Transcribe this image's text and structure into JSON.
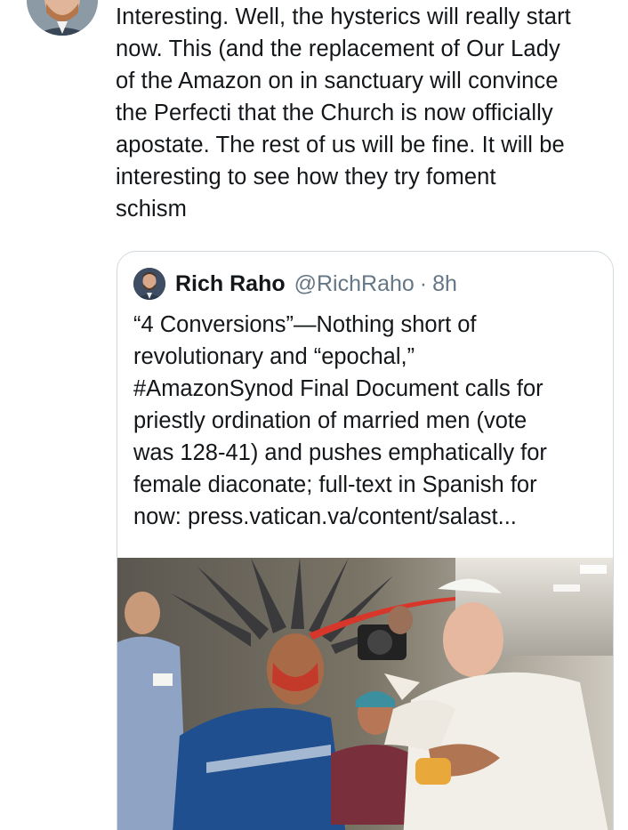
{
  "tweet": {
    "author_avatar": "profile-photo",
    "text_lines": [
      "Interesting. Well, the hysterics will really start",
      "now. This (and the replacement of Our Lady",
      "of the Amazon on in sanctuary will convince",
      "the Perfecti that the Church is now officially",
      "apostate. The rest of us will be fine. It will be",
      "interesting to see how they try foment",
      "schism"
    ]
  },
  "quote": {
    "name": "Rich Raho",
    "handle": "@RichRaho",
    "separator": "·",
    "time": "8h",
    "avatar": "profile-photo",
    "text_lines": [
      "“4 Conversions”—Nothing short of",
      "revolutionary and “epochal,”",
      "#AmazonSynod Final Document calls for",
      "priestly ordination of married men (vote",
      "was 128-41) and pushes emphatically for",
      "female diaconate; full-text in Spanish for",
      "now: press.vatican.va/content/salast..."
    ],
    "image": "photo-pope-with-indigenous-leaders"
  }
}
